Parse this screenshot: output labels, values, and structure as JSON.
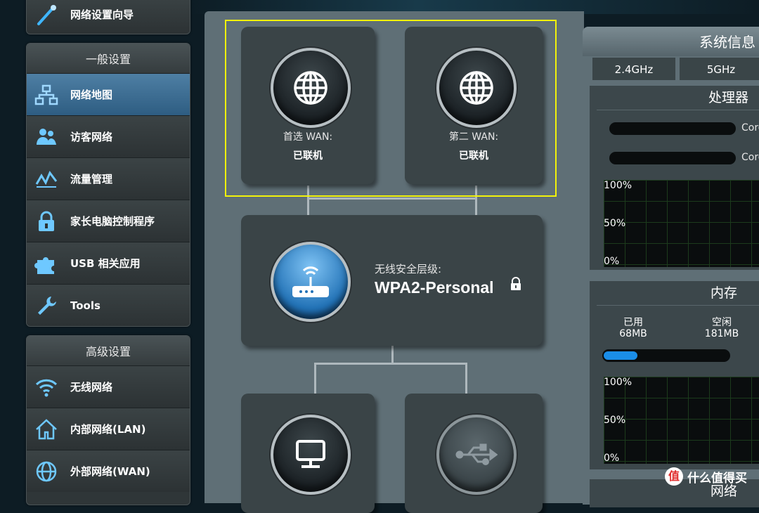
{
  "sidebar": {
    "wizard_label": "网络设置向导",
    "general_title": "一般设置",
    "general_items": [
      {
        "label": "网络地图",
        "icon": "network-map-icon",
        "active": true
      },
      {
        "label": "访客网络",
        "icon": "guest-network-icon"
      },
      {
        "label": "流量管理",
        "icon": "traffic-manager-icon"
      },
      {
        "label": "家长电脑控制程序",
        "icon": "parental-control-lock-icon"
      },
      {
        "label": "USB 相关应用",
        "icon": "usb-puzzle-icon"
      },
      {
        "label": "Tools",
        "icon": "wrench-icon"
      }
    ],
    "advanced_title": "高级设置",
    "advanced_items": [
      {
        "label": "无线网络",
        "icon": "wifi-icon"
      },
      {
        "label": "内部网络(LAN)",
        "icon": "home-icon"
      },
      {
        "label": "外部网络(WAN)",
        "icon": "globe-icon"
      }
    ]
  },
  "map": {
    "wan1": {
      "label": "首选 WAN:",
      "status": "已联机",
      "icon": "globe-icon"
    },
    "wan2": {
      "label": "第二 WAN:",
      "status": "已联机",
      "icon": "globe-icon"
    },
    "router": {
      "security_label": "无线安全层级:",
      "security_value": "WPA2-Personal",
      "icon": "router-icon"
    },
    "clients_icon": "monitor-icon",
    "usb_icon": "usb-icon"
  },
  "sysinfo": {
    "title": "系统信息",
    "tabs": [
      "2.4GHz",
      "5GHz"
    ],
    "cpu": {
      "title": "处理器",
      "cores": [
        "Core",
        "Core"
      ],
      "graph_ticks": [
        "100%",
        "50%",
        "0%"
      ]
    },
    "memory": {
      "title": "内存",
      "used_label": "已用",
      "used_value": "68MB",
      "free_label": "空闲",
      "free_value": "181MB",
      "used_fraction": 0.27,
      "graph_ticks": [
        "100%",
        "50%",
        "0%"
      ]
    },
    "network_title": "网络"
  },
  "watermark": {
    "badge": "值",
    "text": "什么值得买"
  },
  "colors": {
    "highlight": "#f2f20a",
    "active_item": "#3f6f96",
    "panel": "#5f6f76"
  }
}
